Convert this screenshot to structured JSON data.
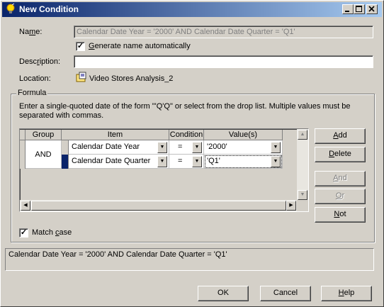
{
  "window": {
    "title": "New Condition"
  },
  "form": {
    "name_label": "Name:",
    "name_value": "Calendar Date Year = '2000' AND Calendar Date Quarter = 'Q1'",
    "generate_label": "Generate name automatically",
    "generate_checked": true,
    "description_label": "Description:",
    "description_value": "",
    "location_label": "Location:",
    "location_value": "Video Stores Analysis_2"
  },
  "formula": {
    "group_title": "Formula",
    "instructions": "Enter a single-quoted date of the form \"'Q'Q\" or select from the drop list. Multiple values must be separated with commas.",
    "columns": [
      "Group",
      "Item",
      "Condition",
      "Value(s)"
    ],
    "group_operator": "AND",
    "rows": [
      {
        "item": "Calendar Date Year",
        "condition": "=",
        "value": "'2000'"
      },
      {
        "item": "Calendar Date Quarter",
        "condition": "=",
        "value": "'Q1'"
      }
    ],
    "match_case_label": "Match case",
    "match_case_checked": true
  },
  "side_buttons": {
    "add": "Add",
    "delete": "Delete",
    "and": "And",
    "or": "Or",
    "not": "Not"
  },
  "summary": "Calendar Date Year = '2000' AND Calendar Date Quarter = 'Q1'",
  "footer": {
    "ok": "OK",
    "cancel": "Cancel",
    "help": "Help"
  },
  "icons": {
    "title": "lightbulb-icon",
    "location": "folder-document-icon",
    "dropdown": "triangle-down-glyph"
  },
  "colors": {
    "title_start": "#0a246a",
    "title_end": "#a6caf0",
    "selection": "#0a246a"
  }
}
